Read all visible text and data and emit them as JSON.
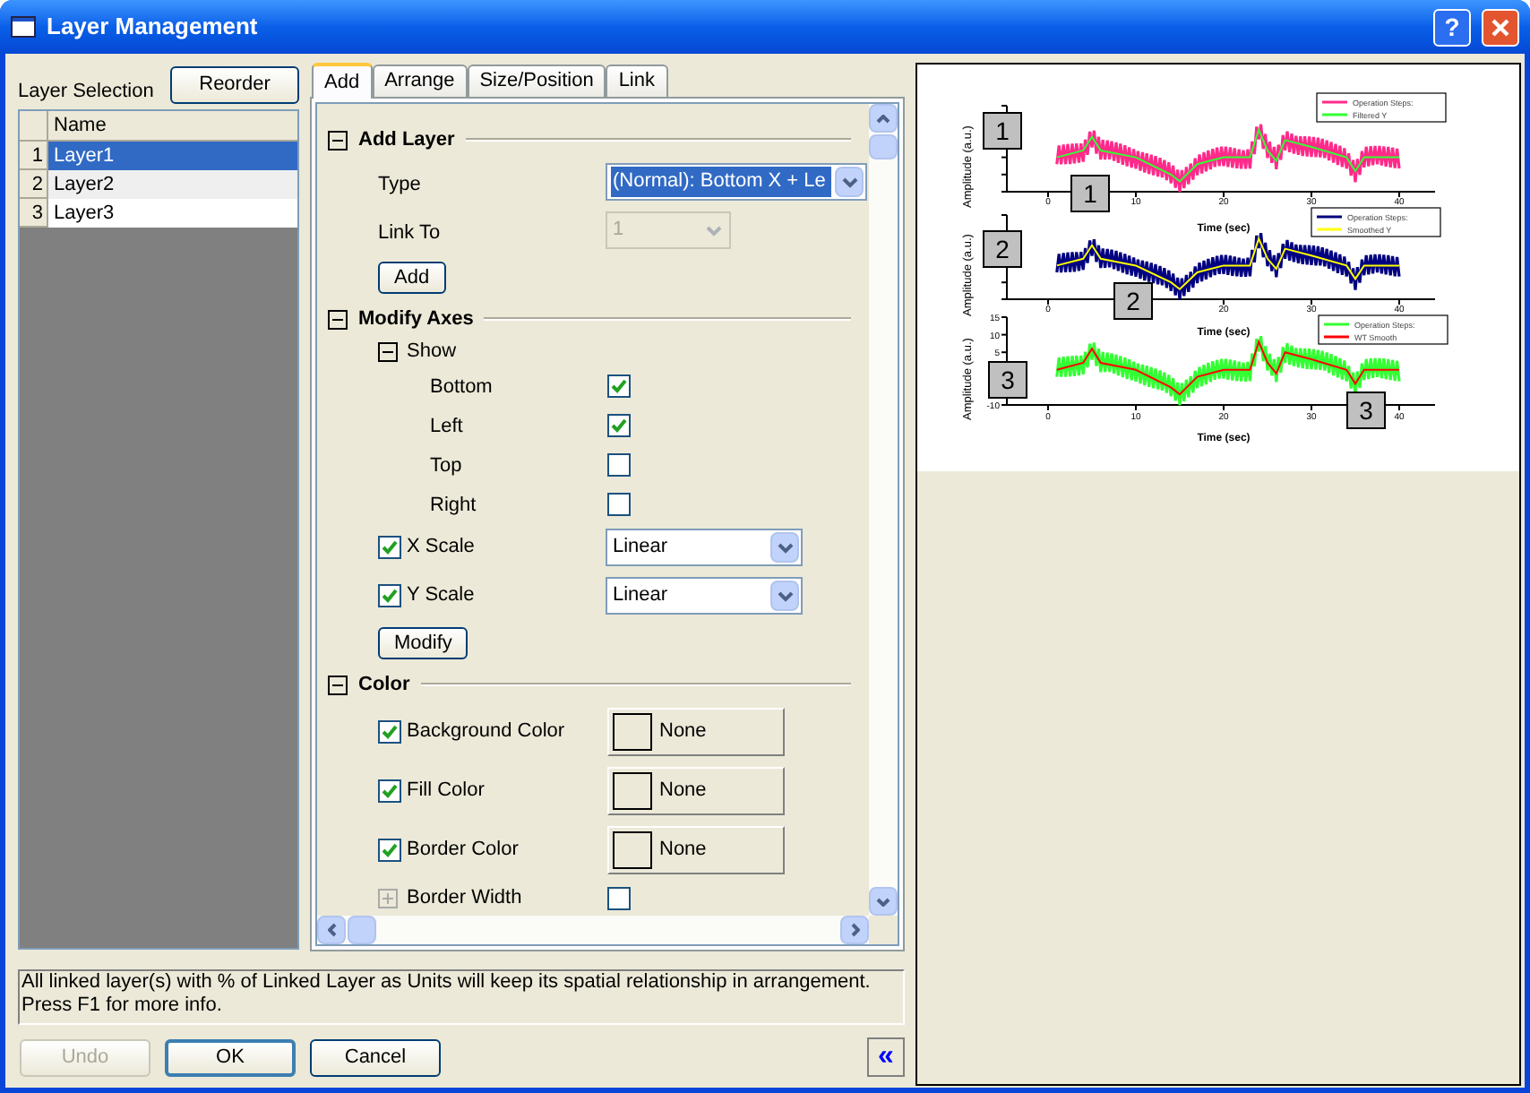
{
  "window": {
    "title": "Layer Management",
    "help_button": "?"
  },
  "layer_selection": {
    "label": "Layer Selection",
    "reorder_button": "Reorder",
    "columns": [
      "Name"
    ],
    "rows": [
      {
        "index": "1",
        "name": "Layer1",
        "selected": true
      },
      {
        "index": "2",
        "name": "Layer2",
        "selected": false
      },
      {
        "index": "3",
        "name": "Layer3",
        "selected": false
      }
    ]
  },
  "tabs": [
    {
      "label": "Add",
      "selected": true
    },
    {
      "label": "Arrange",
      "selected": false
    },
    {
      "label": "Size/Position",
      "selected": false
    },
    {
      "label": "Link",
      "selected": false
    }
  ],
  "sections": [
    {
      "title": "Add Layer",
      "expanded": true,
      "rows": [
        {
          "kind": "combo",
          "label": "Type",
          "value": "(Normal): Bottom X + Le",
          "disabled": false,
          "focused": true
        },
        {
          "kind": "combo",
          "label": "Link To",
          "value": "1",
          "disabled": true,
          "focused": false
        },
        {
          "kind": "button",
          "label": "Add"
        }
      ]
    },
    {
      "title": "Modify Axes",
      "expanded": true,
      "rows": [
        {
          "kind": "group",
          "label": "Show",
          "expanded": true,
          "children": [
            {
              "label": "Bottom",
              "checked": true
            },
            {
              "label": "Left",
              "checked": true
            },
            {
              "label": "Top",
              "checked": false
            },
            {
              "label": "Right",
              "checked": false
            }
          ]
        },
        {
          "kind": "check-combo",
          "label": "X Scale",
          "checked": true,
          "value": "Linear"
        },
        {
          "kind": "check-combo",
          "label": "Y Scale",
          "checked": true,
          "value": "Linear"
        },
        {
          "kind": "button",
          "label": "Modify"
        }
      ]
    },
    {
      "title": "Color",
      "expanded": true,
      "rows": [
        {
          "kind": "check-color",
          "label": "Background Color",
          "checked": true,
          "value": "None"
        },
        {
          "kind": "check-color",
          "label": "Fill Color",
          "checked": true,
          "value": "None"
        },
        {
          "kind": "check-color",
          "label": "Border Color",
          "checked": true,
          "value": "None"
        },
        {
          "kind": "expander-check",
          "label": "Border Width",
          "expanded": false,
          "checked": false
        }
      ]
    }
  ],
  "info": "All linked layer(s) with % of Linked Layer as Units will keep its spatial relationship in arrangement.\nPress F1 for more info.",
  "buttons": [
    {
      "label": "Undo",
      "disabled": true,
      "default": false
    },
    {
      "label": "OK",
      "disabled": false,
      "default": true
    },
    {
      "label": "Cancel",
      "disabled": false,
      "default": false
    }
  ],
  "collapse_button": "«",
  "preview": {
    "plots": [
      {
        "badge": "1",
        "badge2": "1",
        "ylabel": "Amplitude (a.u.)",
        "xlabel": "Time (sec)",
        "xticks": [
          "0",
          "10",
          "20",
          "30",
          "40"
        ],
        "legend": [
          "Operation Steps:",
          "Filtered Y"
        ]
      },
      {
        "badge": "2",
        "badge2": "2",
        "ylabel": "Amplitude (a.u.)",
        "xlabel": "Time (sec)",
        "xticks": [
          "0",
          "20",
          "30",
          "40"
        ],
        "legend": [
          "Operation Steps:",
          "Smoothed Y"
        ]
      },
      {
        "badge": "3",
        "badge2": "3",
        "ylabel": "Amplitude (a.u.)",
        "xlabel": "Time (sec)",
        "xticks": [
          "0",
          "10",
          "20",
          "30",
          "40"
        ],
        "yticks": [
          "15",
          "10",
          "5",
          "-10"
        ],
        "legend": [
          "Operation Steps:",
          "WT Smooth"
        ]
      }
    ]
  }
}
